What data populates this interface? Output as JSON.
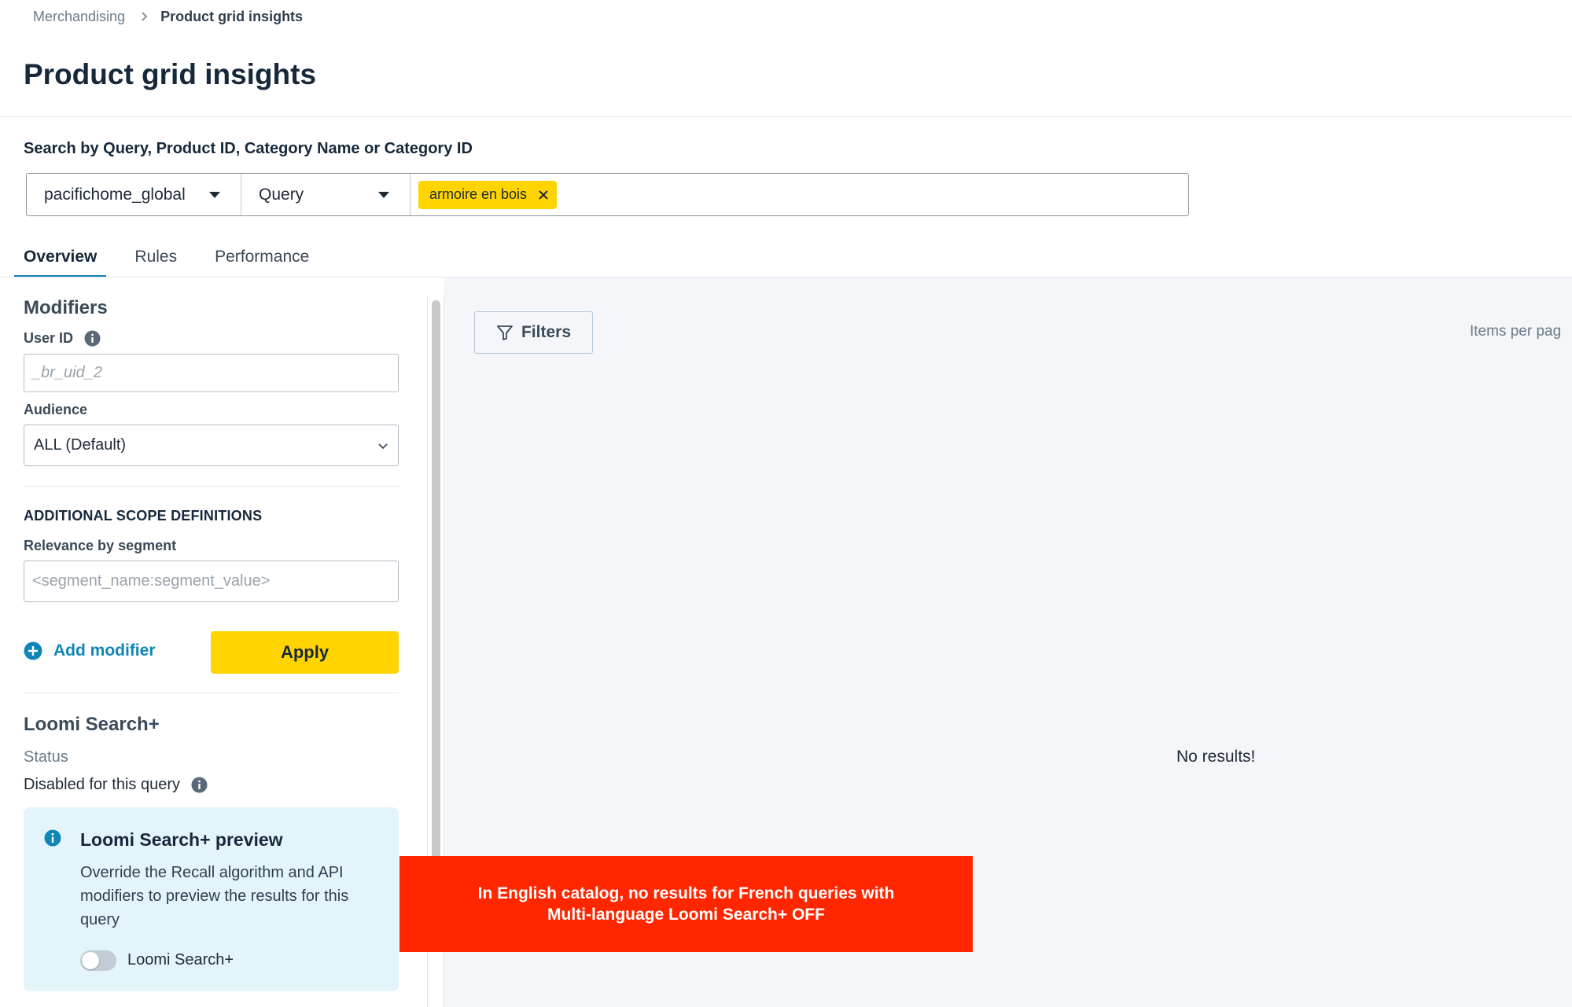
{
  "breadcrumb": {
    "parent": "Merchandising",
    "current": "Product grid insights"
  },
  "page": {
    "title": "Product grid insights"
  },
  "search": {
    "label": "Search by Query, Product ID, Category Name or Category ID",
    "catalog": "pacifichome_global",
    "type": "Query",
    "tags": [
      "armoire en bois"
    ]
  },
  "tabs": [
    {
      "label": "Overview",
      "active": true
    },
    {
      "label": "Rules",
      "active": false
    },
    {
      "label": "Performance",
      "active": false
    }
  ],
  "modifiers": {
    "heading": "Modifiers",
    "user_id_label": "User ID",
    "user_id_placeholder": "_br_uid_2",
    "audience_label": "Audience",
    "audience_value": "ALL (Default)",
    "scope_heading": "ADDITIONAL SCOPE DEFINITIONS",
    "relevance_label": "Relevance by segment",
    "relevance_placeholder": "<segment_name:segment_value>",
    "add_modifier": "Add modifier",
    "apply": "Apply"
  },
  "loomi": {
    "heading": "Loomi Search+",
    "status_label": "Status",
    "status_value": "Disabled for this query",
    "preview_title": "Loomi Search+ preview",
    "preview_text": "Override the Recall algorithm and API modifiers to preview the results for this query",
    "toggle_label": "Loomi Search+",
    "toggle_on": false
  },
  "results": {
    "filters_label": "Filters",
    "items_per_page": "Items per pag",
    "empty_text": "No results!"
  },
  "annotation": {
    "line1": "In English catalog, no results for French queries with",
    "line2": "Multi-language Loomi Search+ OFF"
  },
  "colors": {
    "accent_yellow": "#ffd400",
    "link_blue": "#0f86b6",
    "callout_red": "#ff2600",
    "preview_bg": "#e4f4fb",
    "content_bg": "#f4f6f9"
  }
}
